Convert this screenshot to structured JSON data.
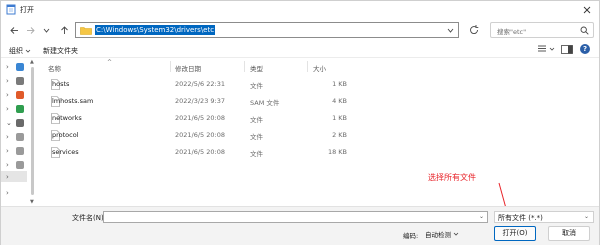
{
  "window": {
    "title": "打开"
  },
  "address": {
    "path": "C:\\Windows\\System32\\drivers\\etc"
  },
  "search": {
    "placeholder": "搜索\"etc\""
  },
  "toolbar": {
    "organize": "组织",
    "new_folder": "新建文件夹"
  },
  "columns": {
    "name": "名称",
    "date": "修改日期",
    "type": "类型",
    "size": "大小"
  },
  "files": [
    {
      "name": "hosts",
      "date": "2022/5/6 22:31",
      "type": "文件",
      "size": "1 KB"
    },
    {
      "name": "lmhosts.sam",
      "date": "2022/3/23 9:37",
      "type": "SAM 文件",
      "size": "4 KB"
    },
    {
      "name": "networks",
      "date": "2021/6/5 20:08",
      "type": "文件",
      "size": "1 KB"
    },
    {
      "name": "protocol",
      "date": "2021/6/5 20:08",
      "type": "文件",
      "size": "2 KB"
    },
    {
      "name": "services",
      "date": "2021/6/5 20:08",
      "type": "文件",
      "size": "18 KB"
    }
  ],
  "annotation": "选择所有文件",
  "bottom": {
    "filename_label": "文件名(N):",
    "filename_value": "",
    "filter": "所有文件 (*.*)",
    "encoding_label": "编码:",
    "encoding_value": "自动检测",
    "open_button": "打开(O)",
    "cancel_button": "取消"
  },
  "colors": {
    "accent": "#0067c0",
    "annotation": "#e8242a"
  }
}
